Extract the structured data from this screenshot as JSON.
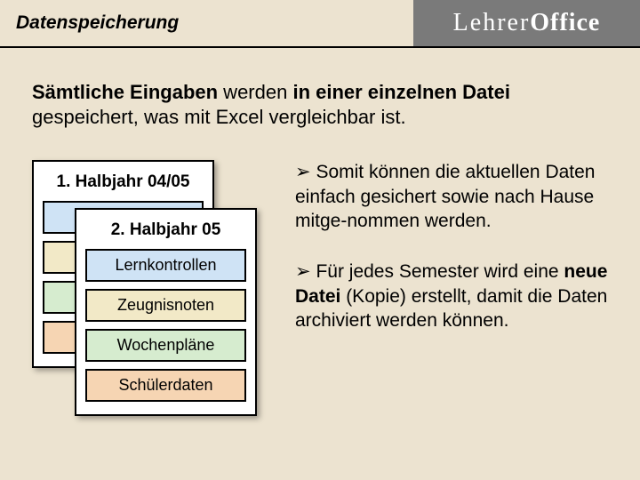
{
  "header": {
    "title": "Datenspeicherung",
    "brand_thin": "Lehrer",
    "brand_bold": "Office"
  },
  "intro": {
    "seg1": "Sämtliche Eingaben",
    "seg2": " werden ",
    "seg3": "in einer einzelnen Datei",
    "seg4": " gespeichert, was mit Excel vergleichbar ist."
  },
  "cards": {
    "c1": {
      "title": "1. Halbjahr 04/05"
    },
    "c2": {
      "title": "2. Halbjahr 05",
      "items": [
        {
          "label": "Lernkontrollen",
          "color": "blue"
        },
        {
          "label": "Zeugnisnoten",
          "color": "beige"
        },
        {
          "label": "Wochenpläne",
          "color": "green"
        },
        {
          "label": "Schülerdaten",
          "color": "orange"
        }
      ]
    }
  },
  "bullets": {
    "b1": {
      "arrow": "➢",
      "plain1": " Somit können die aktuellen Daten einfach gesichert sowie nach Hause mitge‑nommen werden."
    },
    "b2": {
      "arrow": "➢",
      "plain1": " Für jedes Semester wird eine ",
      "strong": "neue Datei",
      "plain2": " (Kopie) erstellt, damit die Daten archiviert werden können."
    }
  }
}
